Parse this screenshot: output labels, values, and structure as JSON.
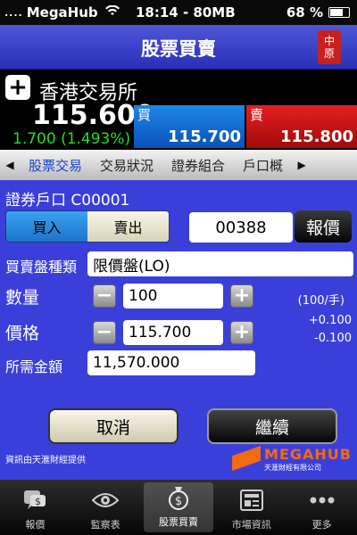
{
  "status_bar": {
    "signal": "....",
    "carrier": "MegaHub",
    "time": "18:14 - 80MB",
    "battery": "68 %"
  },
  "header": {
    "title": "股票買賣",
    "logo_text_top": "中",
    "logo_text_bottom": "原"
  },
  "quote": {
    "exchange": "香港交易所",
    "last_price": "115.600",
    "change": "1.700 (1.493%)",
    "bid_label": "買",
    "bid_price": "115.700",
    "ask_label": "賣",
    "ask_price": "115.800"
  },
  "tabs": {
    "left_arrow": "◀",
    "right_arrow": "▶",
    "items": [
      {
        "label": "股票交易",
        "active": true
      },
      {
        "label": "交易狀況",
        "active": false
      },
      {
        "label": "證券組合",
        "active": false
      },
      {
        "label": "戶口概",
        "active": false
      }
    ]
  },
  "form": {
    "account": "證券戶口 C00001",
    "buy_label": "買入",
    "sell_label": "賣出",
    "stock_code": "00388",
    "quote_button": "報價",
    "order_type_label": "買賣盤種類",
    "order_type_value": "限價盤(LO)",
    "quantity_label": "數量",
    "quantity_value": "100",
    "lot_size": "(100/手)",
    "price_label": "價格",
    "price_value": "115.700",
    "spread_up": "+0.100",
    "spread_down": "-0.100",
    "amount_label": "所需金額",
    "amount_value": "11,570.000",
    "minus": "−",
    "plus": "+"
  },
  "actions": {
    "cancel": "取消",
    "continue": "繼續"
  },
  "footer": {
    "provider": "資訊由天滙財經提供",
    "brand_name": "MEGAHUB",
    "brand_sub": "天滙財經有限公司"
  },
  "bottom_tabs": [
    {
      "label": "報價",
      "icon": "speech-bubble-dollar-icon",
      "active": false
    },
    {
      "label": "監察表",
      "icon": "eye-icon",
      "active": false
    },
    {
      "label": "股票買賣",
      "icon": "money-bag-icon",
      "active": true
    },
    {
      "label": "市場資訊",
      "icon": "newspaper-icon",
      "active": false
    },
    {
      "label": "更多",
      "icon": "more-dots-icon",
      "active": false
    }
  ],
  "colors": {
    "background": "#3b3fd9",
    "price_up": "#22e022",
    "bid": "#1e86e6",
    "ask": "#e52020",
    "tab_active": "#1a3fd6",
    "brand": "#f26a12"
  }
}
